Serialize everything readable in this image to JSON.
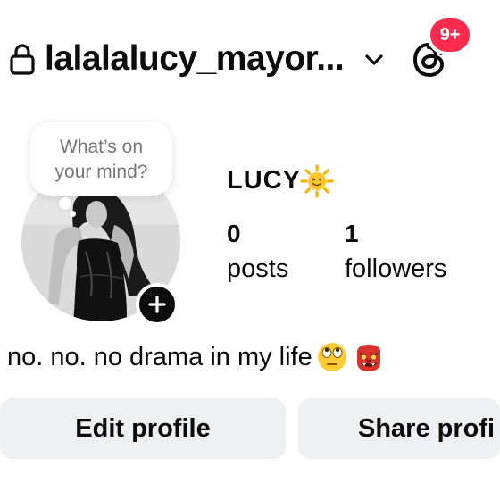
{
  "header": {
    "username": "lalalalucy_mayor...",
    "notification_badge": "9+",
    "badge_color": "#ff2b4f"
  },
  "note": {
    "line1": "What’s on",
    "line2": "your mind?"
  },
  "profile": {
    "display_name": "LUCY",
    "name_emoji": "sun-with-face",
    "stats": [
      {
        "value": "0",
        "label": "posts"
      },
      {
        "value": "1",
        "label": "followers"
      }
    ],
    "bio": "no. no. no drama in my life",
    "bio_emojis": [
      "face-with-rolling-eyes",
      "ogre"
    ]
  },
  "actions": {
    "edit_label": "Edit profile",
    "share_label": "Share profi"
  },
  "icons": {
    "lock": "lock-icon",
    "dropdown": "chevron-down-icon",
    "threads": "threads-icon",
    "add_story": "plus-icon"
  }
}
